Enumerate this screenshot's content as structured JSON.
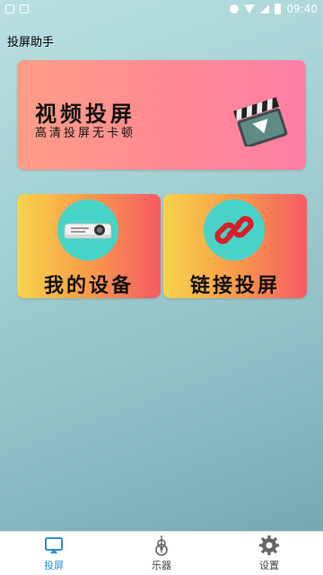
{
  "status_bar": {
    "time": "09:40"
  },
  "app": {
    "title": "投屏助手"
  },
  "hero_card": {
    "title": "视频投屏",
    "subtitle": "高清投屏无卡顿",
    "icon": "clapperboard-icon"
  },
  "tiles": [
    {
      "label": "我的设备",
      "icon": "projector-icon"
    },
    {
      "label": "链接投屏",
      "icon": "link-icon"
    }
  ],
  "bottom_nav": {
    "items": [
      {
        "label": "投屏",
        "icon": "cast-icon",
        "active": true
      },
      {
        "label": "乐器",
        "icon": "guitar-icon",
        "active": false
      },
      {
        "label": "设置",
        "icon": "gear-icon",
        "active": false
      }
    ]
  },
  "colors": {
    "accent": "#2f8fd8",
    "hero_gradient": [
      "#ff9e87",
      "#ff7fa5"
    ],
    "tile_gradient": [
      "#f7d44b",
      "#f55b65"
    ],
    "tile_circle": "#48d3c8"
  }
}
